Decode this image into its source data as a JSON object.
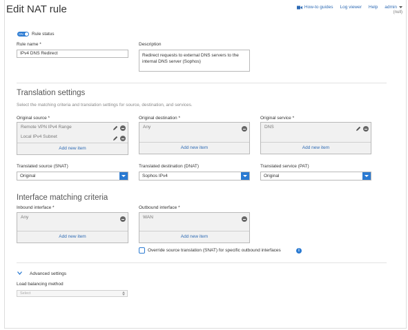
{
  "page": {
    "title": "Edit NAT rule"
  },
  "top_links": {
    "howto": "How-to guides",
    "logviewer": "Log viewer",
    "help": "Help",
    "admin": "admin",
    "admin_sub": "(null)"
  },
  "rule_status": {
    "toggle_text": "ON",
    "label": "Rule status"
  },
  "rule_name": {
    "label": "Rule name *",
    "value": "IPv4 DNS Redirect"
  },
  "description": {
    "label": "Description",
    "value": "Redirect requests to external DNS servers to the internal DNS server (Sophos)"
  },
  "translation": {
    "heading": "Translation settings",
    "subtitle": "Select the matching criteria and translation settings for source, destination, and services.",
    "orig_source": {
      "label": "Original source *",
      "items": [
        "Remote VPN IPv4 Range",
        "Local IPv4 Subnet"
      ],
      "add": "Add new item"
    },
    "orig_destination": {
      "label": "Original destination *",
      "items": [
        "Any"
      ],
      "add": "Add new item"
    },
    "orig_service": {
      "label": "Original service *",
      "items": [
        "DNS"
      ],
      "add": "Add new item"
    },
    "snat": {
      "label": "Translated source (SNAT)",
      "value": "Original"
    },
    "dnat": {
      "label": "Translated destination (DNAT)",
      "value": "Sophos IPv4"
    },
    "pat": {
      "label": "Translated service (PAT)",
      "value": "Original"
    }
  },
  "interface": {
    "heading": "Interface matching criteria",
    "inbound": {
      "label": "Inbound interface *",
      "items": [
        "Any"
      ],
      "add": "Add new item"
    },
    "outbound": {
      "label": "Outbound interface *",
      "items": [
        "WAN"
      ],
      "add": "Add new item"
    },
    "override_label": "Override source translation (SNAT) for specific outbound interfaces"
  },
  "advanced": {
    "label": "Advanced settings",
    "lb_label": "Load balancing method",
    "lb_value": "Select"
  },
  "colors": {
    "accent": "#2a7ad2",
    "link": "#2d6ab4"
  },
  "icons": [
    "video-icon",
    "chevron-down-icon",
    "pencil-icon",
    "remove-icon",
    "info-icon"
  ]
}
